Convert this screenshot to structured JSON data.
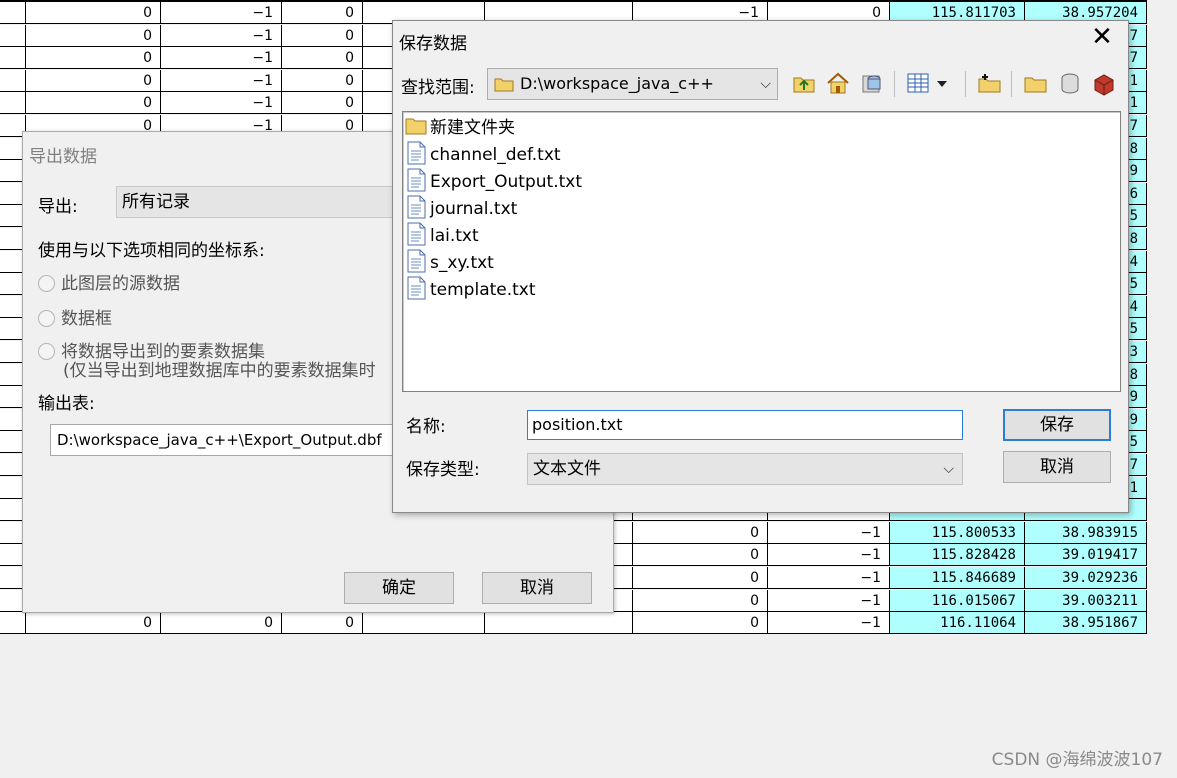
{
  "table": {
    "rows": [
      [
        "0",
        "−1",
        "0",
        "",
        "",
        "−1",
        "0",
        "115.811703",
        "38.957204"
      ],
      [
        "0",
        "−1",
        "0",
        "",
        "",
        "",
        "",
        "",
        "7"
      ],
      [
        "0",
        "−1",
        "0",
        "",
        "",
        "",
        "",
        "",
        "7"
      ],
      [
        "0",
        "−1",
        "0",
        "",
        "",
        "",
        "",
        "",
        "1"
      ],
      [
        "0",
        "−1",
        "0",
        "",
        "",
        "",
        "",
        "",
        "1"
      ],
      [
        "0",
        "−1",
        "0",
        "",
        "",
        "",
        "",
        "",
        "7"
      ],
      [
        "",
        "",
        "",
        "",
        "",
        "",
        "",
        "",
        "8"
      ],
      [
        "",
        "",
        "",
        "",
        "",
        "",
        "",
        "",
        "9"
      ],
      [
        "",
        "",
        "",
        "",
        "",
        "",
        "",
        "",
        "6"
      ],
      [
        "",
        "",
        "",
        "",
        "",
        "",
        "",
        "",
        "5"
      ],
      [
        "",
        "",
        "",
        "",
        "",
        "",
        "",
        "",
        "8"
      ],
      [
        "",
        "",
        "",
        "",
        "",
        "",
        "",
        "",
        "4"
      ],
      [
        "",
        "",
        "",
        "",
        "",
        "",
        "",
        "",
        "5"
      ],
      [
        "",
        "",
        "",
        "",
        "",
        "",
        "",
        "",
        "4"
      ],
      [
        "",
        "",
        "",
        "",
        "",
        "",
        "",
        "",
        "5"
      ],
      [
        "",
        "",
        "",
        "",
        "",
        "",
        "",
        "",
        "3"
      ],
      [
        "",
        "",
        "",
        "",
        "",
        "",
        "",
        "",
        "8"
      ],
      [
        "",
        "",
        "",
        "",
        "",
        "",
        "",
        "",
        "9"
      ],
      [
        "",
        "",
        "",
        "",
        "",
        "",
        "",
        "",
        "9"
      ],
      [
        "",
        "",
        "",
        "",
        "",
        "",
        "",
        "",
        "5"
      ],
      [
        "",
        "",
        "",
        "",
        "",
        "",
        "",
        "",
        "7"
      ],
      [
        "",
        "",
        "",
        "",
        "",
        "",
        "",
        "",
        "1"
      ],
      [
        "",
        "",
        "",
        "",
        "",
        "",
        "",
        "",
        ""
      ],
      [
        "",
        "",
        "",
        "",
        "",
        "0",
        "−1",
        "115.800533",
        "38.983915"
      ],
      [
        "",
        "",
        "",
        "",
        "",
        "0",
        "−1",
        "115.828428",
        "39.019417"
      ],
      [
        "",
        "",
        "",
        "",
        "",
        "0",
        "−1",
        "115.846689",
        "39.029236"
      ],
      [
        "",
        "",
        "",
        "",
        "",
        "0",
        "−1",
        "116.015067",
        "39.003211"
      ],
      [
        "0",
        "0",
        "0",
        "",
        "",
        "0",
        "−1",
        "116.11064",
        "38.951867"
      ]
    ]
  },
  "export_dialog": {
    "title": "导出数据",
    "export_label": "导出:",
    "export_value": "所有记录",
    "coord_label": "使用与以下选项相同的坐标系:",
    "radio_options": [
      "此图层的源数据",
      "数据框",
      "将数据导出到的要素数据集"
    ],
    "radio_note": "(仅当导出到地理数据库中的要素数据集时",
    "output_label": "输出表:",
    "output_path": "D:\\workspace_java_c++\\Export_Output.dbf",
    "ok_label": "确定",
    "cancel_label": "取消"
  },
  "save_dialog": {
    "title": "保存数据",
    "lookin_label": "查找范围:",
    "lookin_value": "D:\\workspace_java_c++",
    "files": [
      {
        "name": "新建文件夹",
        "kind": "folder"
      },
      {
        "name": "channel_def.txt",
        "kind": "text"
      },
      {
        "name": "Export_Output.txt",
        "kind": "text"
      },
      {
        "name": "journal.txt",
        "kind": "text"
      },
      {
        "name": "lai.txt",
        "kind": "text"
      },
      {
        "name": "s_xy.txt",
        "kind": "text"
      },
      {
        "name": "template.txt",
        "kind": "text"
      }
    ],
    "name_label": "名称:",
    "name_value": "position.txt",
    "type_label": "保存类型:",
    "type_value": "文本文件",
    "save_label": "保存",
    "cancel_label": "取消"
  },
  "watermark": "CSDN @海绵波波107",
  "colors": {
    "cyan_cell": "#b0ffff",
    "focus_blue": "#2b7dd8",
    "folder_yellow": "#f3d16a"
  }
}
